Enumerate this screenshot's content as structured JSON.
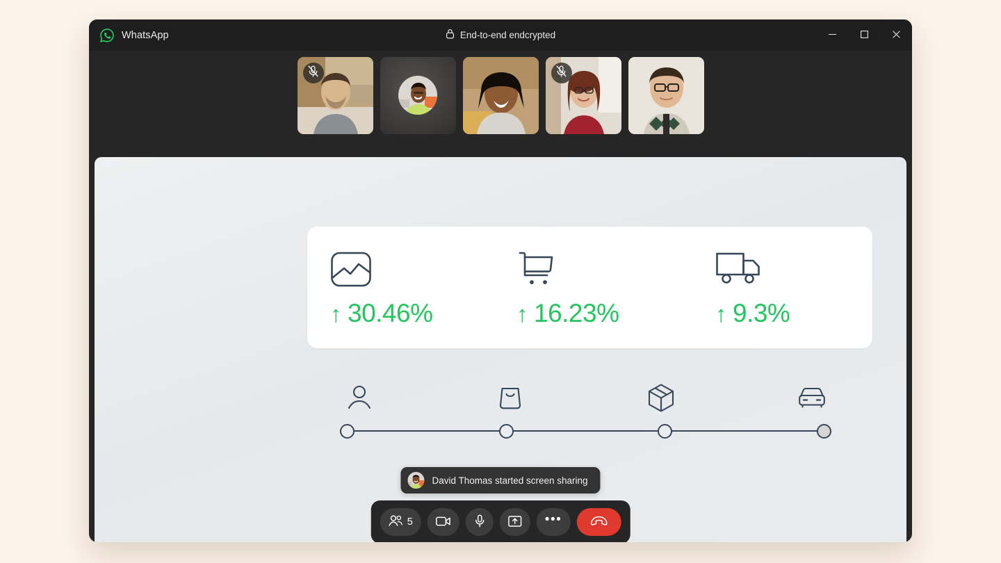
{
  "app": {
    "brand_name": "WhatsApp",
    "brand_icon": "whatsapp-logo-icon",
    "encryption_label": "End-to-end endcrypted",
    "lock_icon": "lock-icon",
    "window_controls": [
      {
        "name": "minimize",
        "icon": "minimize-icon"
      },
      {
        "name": "maximize",
        "icon": "maximize-icon"
      },
      {
        "name": "close",
        "icon": "close-icon"
      }
    ]
  },
  "filmstrip": {
    "participants": [
      {
        "id": "p1",
        "video": true,
        "muted": true,
        "skin": "#D9B78E",
        "bg": "#BCA07A",
        "shirt": "#8A8F94",
        "hair": "#4A3728"
      },
      {
        "id": "p2",
        "video": false,
        "muted": false,
        "skin": "#7A4B2A",
        "bg": "#D8D5CE",
        "shirt": "#C6E06A",
        "hair": "#1C1208"
      },
      {
        "id": "p3",
        "video": true,
        "muted": false,
        "skin": "#8C5A35",
        "bg": "#C8A87E",
        "shirt": "#D7D4CE",
        "hair": "#140D07"
      },
      {
        "id": "p4",
        "video": true,
        "muted": true,
        "skin": "#E3BA9A",
        "bg": "#E0DAD0",
        "shirt": "#A32230",
        "hair": "#6B2F1C"
      },
      {
        "id": "p5",
        "video": true,
        "muted": false,
        "skin": "#E0B894",
        "bg": "#E8E4DC",
        "shirt": "#4A5B4A",
        "hair": "#3A2A1C"
      }
    ],
    "mic_off_icon": "mic-off-icon"
  },
  "stage": {
    "kpis": [
      {
        "icon": "chart-image-icon",
        "arrow": "↑",
        "value": "30.46%"
      },
      {
        "icon": "shopping-cart-icon",
        "arrow": "↑",
        "value": "16.23%"
      },
      {
        "icon": "delivery-truck-icon",
        "arrow": "↑",
        "value": "9.3%"
      }
    ],
    "stepper": {
      "steps": [
        {
          "icon": "person-icon",
          "filled": false
        },
        {
          "icon": "shopping-bag-icon",
          "filled": false
        },
        {
          "icon": "package-box-icon",
          "filled": false
        },
        {
          "icon": "car-icon",
          "filled": true
        }
      ]
    },
    "accent_green": "#22C55E",
    "ink": "#37475A"
  },
  "toast": {
    "text": "David Thomas started screen sharing",
    "avatar": "participant-avatar"
  },
  "controls": {
    "participants_count": "5",
    "buttons": [
      {
        "name": "participants-button",
        "icon": "people-icon"
      },
      {
        "name": "camera-button",
        "icon": "video-camera-icon"
      },
      {
        "name": "microphone-button",
        "icon": "microphone-icon"
      },
      {
        "name": "share-screen-button",
        "icon": "share-screen-icon"
      },
      {
        "name": "more-options-button",
        "icon": "more-dots-icon",
        "glyph": "•••"
      },
      {
        "name": "end-call-button",
        "icon": "hangup-phone-icon"
      }
    ],
    "hangup_color": "#E03A2F"
  }
}
